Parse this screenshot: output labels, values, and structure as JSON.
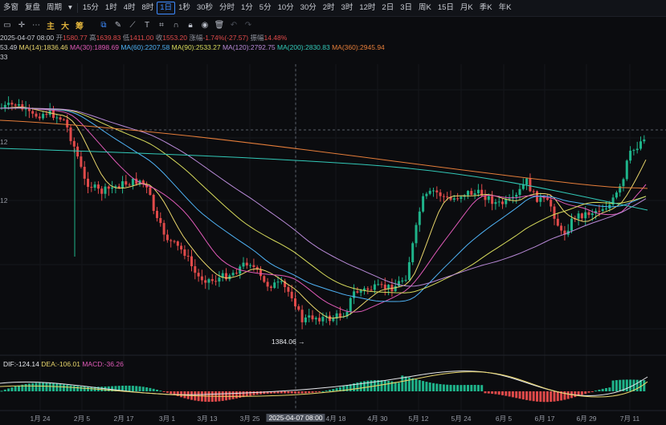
{
  "toolbar": {
    "items": [
      "多窗",
      "复盘",
      "周期",
      "15分",
      "1时",
      "4时",
      "8时",
      "1日",
      "1秒",
      "30秒",
      "分时",
      "1分",
      "5分",
      "10分",
      "30分",
      "2时",
      "3时",
      "12时",
      "2日",
      "3日",
      "周K",
      "15日",
      "月K",
      "季K",
      "年K"
    ],
    "active": "1日"
  },
  "drawbar": {
    "main_label": "主",
    "big_label": "大",
    "chip_label": "筹"
  },
  "ohlc": {
    "date": "2025-04-07 08:00",
    "open_label": "开",
    "open": "1580.77",
    "high_label": "高",
    "high": "1639.83",
    "low_label": "低",
    "low": "1411.00",
    "close_label": "收",
    "close": "1553.20",
    "chg_label": "涨幅",
    "chg": "-1.74%(-27.57)",
    "amp_label": "振幅",
    "amp": "14.48%"
  },
  "ma_line": {
    "prefix": "53.49",
    "ma14": "MA(14):1836.46",
    "ma30": "MA(30):1898.69",
    "ma60": "MA(60):2207.58",
    "ma90": "MA(90):2533.27",
    "ma120": "MA(120):2792.75",
    "ma200": "MA(200):2830.83",
    "ma360": "MA(360):2945.94"
  },
  "ma_colors": {
    "ma14": "#e9d66b",
    "ma30": "#e05ab8",
    "ma60": "#4fb3f6",
    "ma90": "#d8dc5c",
    "ma120": "#b98ad8",
    "ma200": "#32c9b8",
    "ma360": "#e67e3a"
  },
  "third_line": "33",
  "y_left_labels": [
    "12",
    "12"
  ],
  "low_marker": "1384.06",
  "macd": {
    "dif": "DIF:-124.14",
    "dea": "DEA:-106.01",
    "macd": "MACD:-36.26"
  },
  "x_axis": [
    "1月 24",
    "2月 5",
    "2月 17",
    "3月 1",
    "3月 13",
    "3月 25",
    "2025-04-07 08:00",
    "4月 18",
    "4月 30",
    "5月 12",
    "5月 24",
    "6月 5",
    "6月 17",
    "6月 29",
    "7月 11"
  ],
  "colors": {
    "up": "#1fb38a",
    "down": "#e04a4a",
    "active": "#3d8bff"
  }
}
